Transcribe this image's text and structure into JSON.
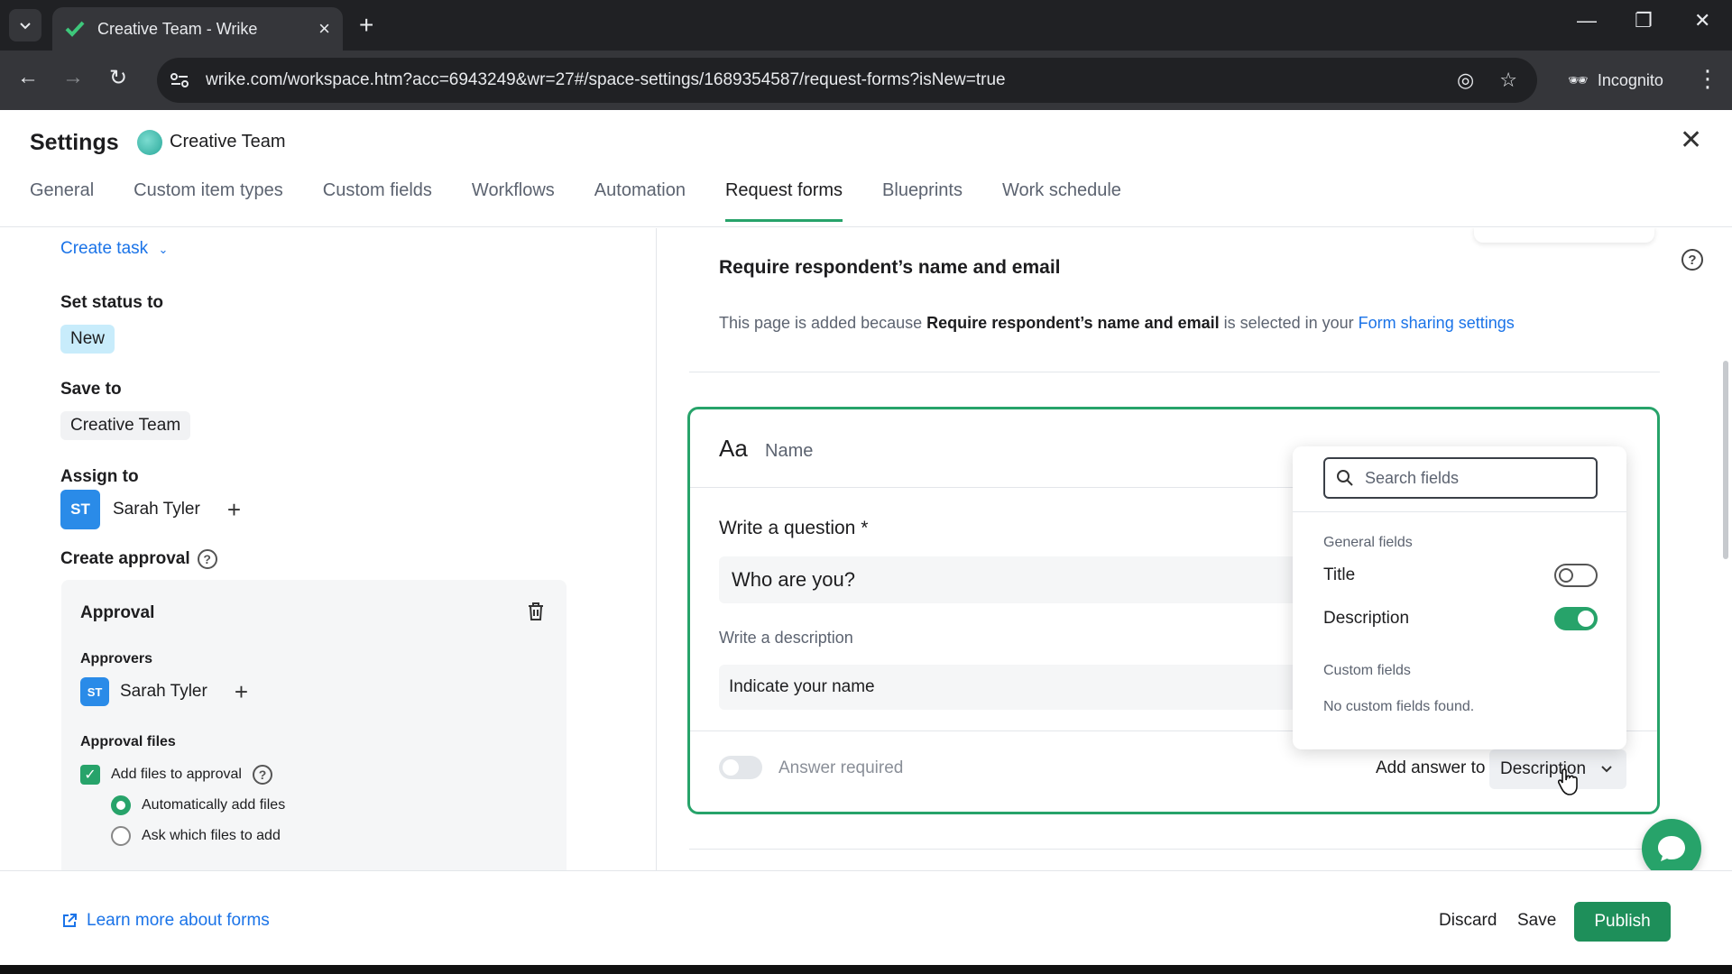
{
  "browser": {
    "tab_title": "Creative Team - Wrike",
    "url": "wrike.com/workspace.htm?acc=6943249&wr=27#/space-settings/1689354587/request-forms?isNew=true",
    "incognito_label": "Incognito"
  },
  "header": {
    "title": "Settings",
    "space_name": "Creative Team",
    "tabs": [
      {
        "label": "General"
      },
      {
        "label": "Custom item types"
      },
      {
        "label": "Custom fields"
      },
      {
        "label": "Workflows"
      },
      {
        "label": "Automation"
      },
      {
        "label": "Request forms",
        "active": true
      },
      {
        "label": "Blueprints"
      },
      {
        "label": "Work schedule"
      }
    ]
  },
  "left": {
    "create_task_label": "Create task",
    "set_status_label": "Set status to",
    "status_value": "New",
    "save_to_label": "Save to",
    "save_to_value": "Creative Team",
    "assign_to_label": "Assign to",
    "assignee": {
      "initials": "ST",
      "name": "Sarah Tyler"
    },
    "create_approval_label": "Create approval",
    "approval": {
      "title": "Approval",
      "approvers_label": "Approvers",
      "approver": {
        "initials": "ST",
        "name": "Sarah Tyler"
      },
      "files_label": "Approval files",
      "add_files_label": "Add files to approval",
      "add_files_checked": true,
      "options": [
        {
          "label": "Automatically add files",
          "selected": true
        },
        {
          "label": "Ask which files to add",
          "selected": false
        }
      ]
    }
  },
  "right": {
    "section_title": "Require respondent’s name and email",
    "desc_prefix": "This page is added because ",
    "desc_bold": "Require respondent’s name and email",
    "desc_middle": " is selected in your ",
    "desc_link": "Form sharing settings",
    "question": {
      "type_icon": "Aa",
      "name_placeholder": "Name",
      "question_label": "Write a question *",
      "question_value": "Who are you?",
      "description_label": "Write a description",
      "description_value": "Indicate your name",
      "answer_required_label": "Answer required",
      "answer_required": false,
      "add_answer_label": "Add answer to",
      "add_answer_value": "Description"
    },
    "popover": {
      "search_placeholder": "Search fields",
      "general_fields_label": "General fields",
      "general_fields": [
        {
          "label": "Title",
          "enabled": false
        },
        {
          "label": "Description",
          "enabled": true
        }
      ],
      "custom_fields_label": "Custom fields",
      "no_custom_fields": "No custom fields found."
    }
  },
  "footer": {
    "learn_more": "Learn more about forms",
    "discard": "Discard",
    "save": "Save",
    "publish": "Publish"
  },
  "colors": {
    "accent_green": "#27a36a",
    "publish_green": "#1e8f5a",
    "link_blue": "#1a73e8",
    "status_pill": "#c8ecfb"
  }
}
